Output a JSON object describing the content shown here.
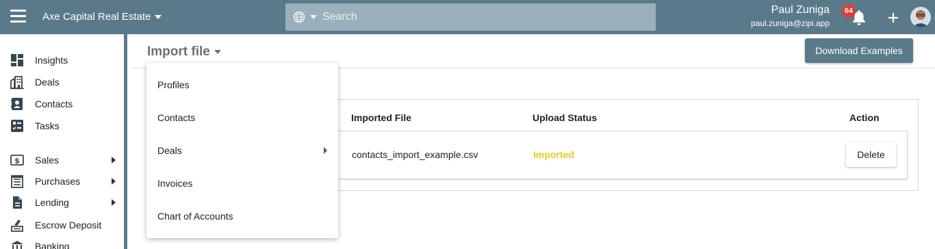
{
  "topbar": {
    "company": "Axe Capital Real Estate",
    "search_placeholder": "Search",
    "user_name": "Paul Zuniga",
    "user_email": "paul.zuniga@zipi.app",
    "notification_count": "64"
  },
  "sidebar": {
    "items": [
      {
        "label": "Insights",
        "icon": "dashboard-icon"
      },
      {
        "label": "Deals",
        "icon": "building-icon"
      },
      {
        "label": "Contacts",
        "icon": "contact-card-icon"
      },
      {
        "label": "Tasks",
        "icon": "checklist-icon"
      },
      {
        "label": "Sales",
        "icon": "dollar-invoice-icon"
      },
      {
        "label": "Purchases",
        "icon": "receipt-list-icon"
      },
      {
        "label": "Lending",
        "icon": "document-icon"
      },
      {
        "label": "Escrow Deposit",
        "icon": "deposit-icon"
      },
      {
        "label": "Banking",
        "icon": "bank-icon"
      }
    ]
  },
  "page": {
    "title": "Import file",
    "download_button": "Download Examples"
  },
  "table": {
    "headers": {
      "file": "Imported File",
      "status": "Upload Status",
      "action": "Action"
    },
    "rows": [
      {
        "file": "contacts_import_example.csv",
        "status": "Imported",
        "action": "Delete"
      }
    ]
  },
  "menu": {
    "items": [
      "Profiles",
      "Contacts",
      "Deals",
      "Invoices",
      "Chart of Accounts"
    ]
  },
  "colors": {
    "topbar": "#5a7a8a",
    "status_imported": "#f2c81a",
    "badge": "#e53935"
  }
}
